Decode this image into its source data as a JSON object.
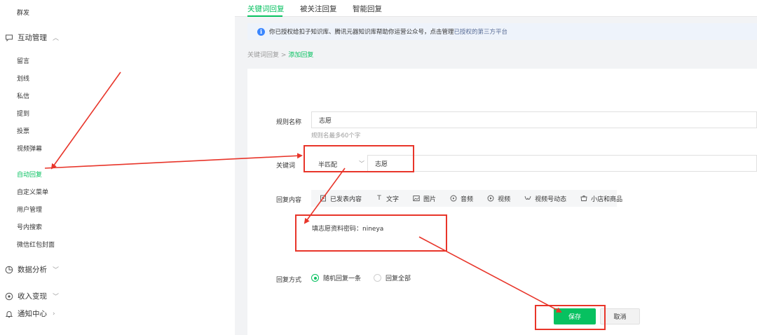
{
  "sidebar": {
    "top_item": "群发",
    "interaction_group": {
      "label": "互动管理",
      "icon": "message-icon"
    },
    "items": [
      "留言",
      "划线",
      "私信",
      "提到",
      "投票",
      "视频弹幕",
      "自动回复",
      "自定义菜单",
      "用户管理",
      "号内搜索",
      "微信红包封面"
    ],
    "active_item": "自动回复",
    "groups": [
      {
        "label": "数据分析",
        "icon": "pie-chart-icon"
      },
      {
        "label": "收入变现",
        "icon": "coin-icon"
      },
      {
        "label": "通知中心",
        "icon": "bell-icon"
      }
    ]
  },
  "tabs": [
    "关键词回复",
    "被关注回复",
    "智能回复"
  ],
  "active_tab": "关键词回复",
  "notice": {
    "text": "你已授权给扣子知识库、腾讯元器知识库帮助你运营公众号，点击管理",
    "link": "已授权的第三方平台"
  },
  "breadcrumb": {
    "parent": "关键词回复",
    "separator": ">",
    "current": "添加回复"
  },
  "form": {
    "rule_name_label": "规则名称",
    "rule_name_value": "志愿",
    "rule_name_hint": "规则名最多60个字",
    "keyword_label": "关键词",
    "match_mode": "半匹配",
    "keyword_value": "志愿",
    "reply_content_label": "回复内容",
    "reply_tools": [
      {
        "label": "已发表内容",
        "icon": "article-icon"
      },
      {
        "label": "文字",
        "icon": "text-icon"
      },
      {
        "label": "图片",
        "icon": "image-icon"
      },
      {
        "label": "音频",
        "icon": "audio-icon"
      },
      {
        "label": "视频",
        "icon": "video-icon"
      },
      {
        "label": "视频号动态",
        "icon": "channels-icon"
      },
      {
        "label": "小店和商品",
        "icon": "shop-icon"
      }
    ],
    "reply_text": "填志愿资料密码：nineya",
    "reply_mode_label": "回复方式",
    "reply_mode_options": [
      "随机回复一条",
      "回复全部"
    ],
    "reply_mode_selected": "随机回复一条"
  },
  "buttons": {
    "save": "保存",
    "cancel": "取消"
  },
  "colors": {
    "accent": "#07c160",
    "annotation": "#e8352a",
    "link": "#576b95",
    "info": "#3a86ff"
  }
}
